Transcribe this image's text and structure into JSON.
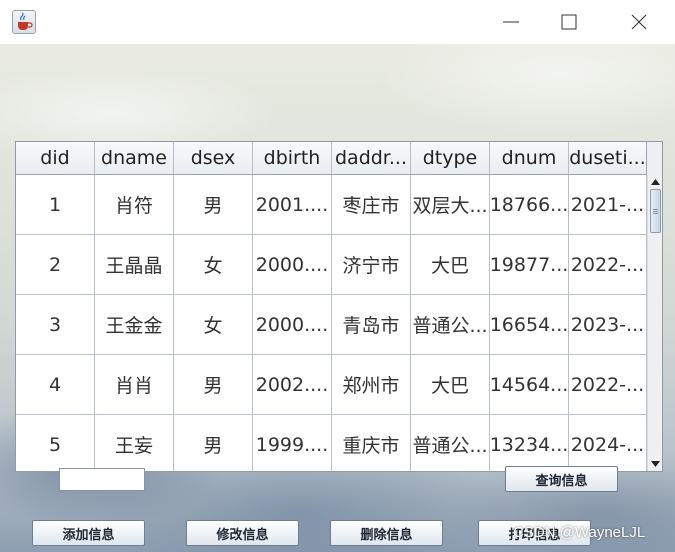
{
  "window": {
    "icons": {
      "app": "java-coffee-cup-icon",
      "minimize": "minimize-icon",
      "maximize": "maximize-icon",
      "close": "close-icon"
    }
  },
  "table": {
    "columns": [
      "did",
      "dname",
      "dsex",
      "dbirth",
      "daddr...",
      "dtype",
      "dnum",
      "duseti..."
    ],
    "rows": [
      [
        "1",
        "肖符",
        "男",
        "2001....",
        "枣庄市",
        "双层大...",
        "18766...",
        "2021-..."
      ],
      [
        "2",
        "王晶晶",
        "女",
        "2000....",
        "济宁市",
        "大巴",
        "19877...",
        "2022-..."
      ],
      [
        "3",
        "王金金",
        "女",
        "2000....",
        "青岛市",
        "普通公...",
        "16654...",
        "2023-..."
      ],
      [
        "4",
        "肖肖",
        "男",
        "2002....",
        "郑州市",
        "大巴",
        "14564...",
        "2022-..."
      ],
      [
        "5",
        "王妄",
        "男",
        "1999....",
        "重庆市",
        "普通公...",
        "13234...",
        "2024-..."
      ]
    ]
  },
  "search": {
    "value": ""
  },
  "buttons": {
    "query": "查询信息",
    "add": "添加信息",
    "edit": "修改信息",
    "delete": "删除信息",
    "print": "打印信息"
  },
  "watermark": "CSDN @WayneLJL"
}
